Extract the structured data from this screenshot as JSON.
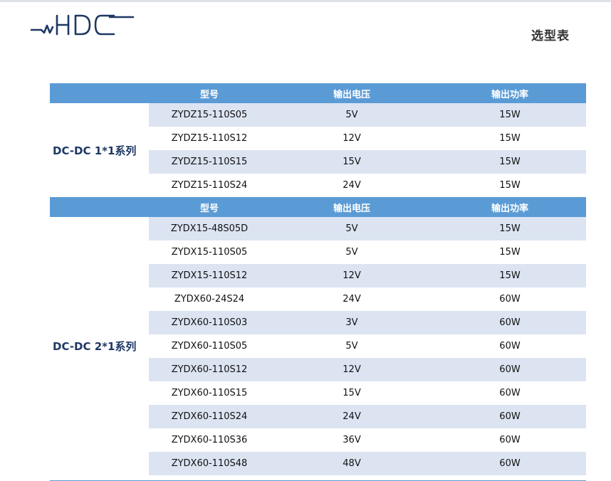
{
  "header": {
    "page_title": "选型表"
  },
  "colors": {
    "header_bg": "#5b9bd5",
    "stripe_bg": "#dce4f2",
    "series_text": "#1f3864",
    "logo": "#1f3864"
  },
  "columns": {
    "model": "型号",
    "voltage": "输出电压",
    "power": "输出功率"
  },
  "groups": [
    {
      "series": "DC-DC 1*1系列",
      "rows": [
        {
          "model": "ZYDZ15-110S05",
          "voltage": "5V",
          "power": "15W"
        },
        {
          "model": "ZYDZ15-110S12",
          "voltage": "12V",
          "power": "15W"
        },
        {
          "model": "ZYDZ15-110S15",
          "voltage": "15V",
          "power": "15W"
        },
        {
          "model": "ZYDZ15-110S24",
          "voltage": "24V",
          "power": "15W"
        }
      ]
    },
    {
      "series": "DC-DC 2*1系列",
      "rows": [
        {
          "model": "ZYDX15-48S05D",
          "voltage": "5V",
          "power": "15W"
        },
        {
          "model": "ZYDX15-110S05",
          "voltage": "5V",
          "power": "15W"
        },
        {
          "model": "ZYDX15-110S12",
          "voltage": "12V",
          "power": "15W"
        },
        {
          "model": "ZYDX60-24S24",
          "voltage": "24V",
          "power": "60W"
        },
        {
          "model": "ZYDX60-110S03",
          "voltage": "3V",
          "power": "60W"
        },
        {
          "model": "ZYDX60-110S05",
          "voltage": "5V",
          "power": "60W"
        },
        {
          "model": "ZYDX60-110S12",
          "voltage": "12V",
          "power": "60W"
        },
        {
          "model": "ZYDX60-110S15",
          "voltage": "15V",
          "power": "60W"
        },
        {
          "model": "ZYDX60-110S24",
          "voltage": "24V",
          "power": "60W"
        },
        {
          "model": "ZYDX60-110S36",
          "voltage": "36V",
          "power": "60W"
        },
        {
          "model": "ZYDX60-110S48",
          "voltage": "48V",
          "power": "60W"
        }
      ]
    }
  ]
}
